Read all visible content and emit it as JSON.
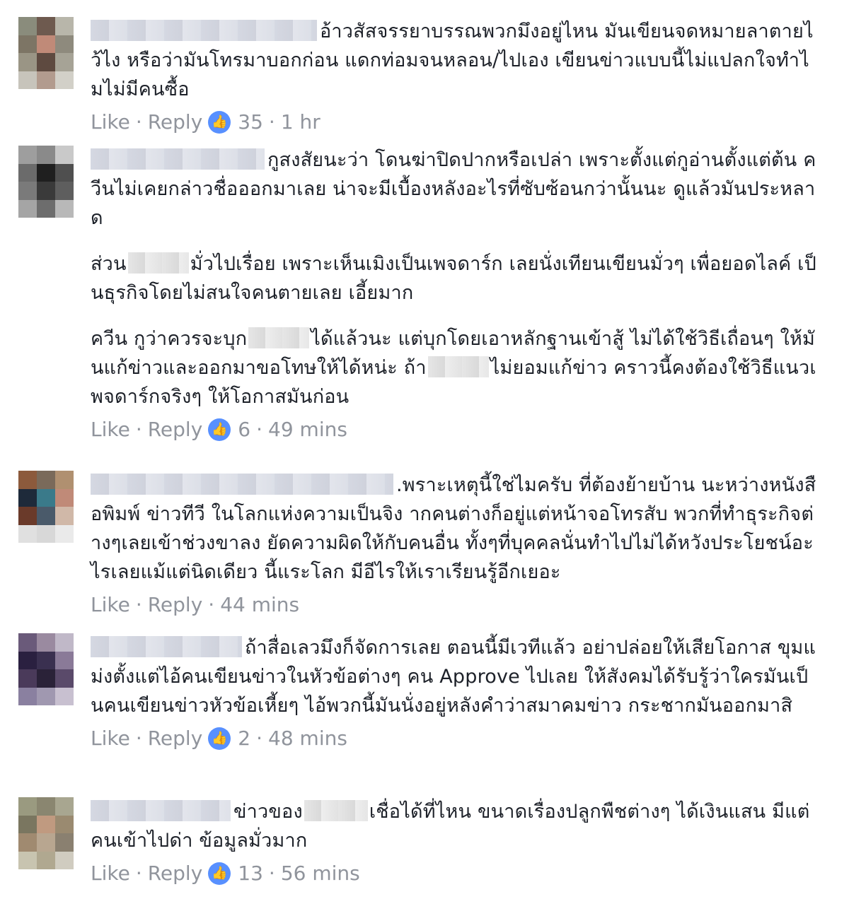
{
  "actions": {
    "like": "Like",
    "reply": "Reply",
    "dot": "·"
  },
  "comments": [
    {
      "paragraphs": [
        "อ้าวสัสจรรยาบรรณพวกมึงอยู่ไหน มันเขียนจดหมายลาตายไว้ไง หรือว่ามันโทรมาบอกก่อน แดกท่อมจนหลอน/ไปเอง เขียนข่าวแบบนี้ไม่แปลกใจทำไมไม่มีคนซื้อ"
      ],
      "likes": "35",
      "time": "1 hr"
    },
    {
      "paragraphs": [
        "กูสงสัยนะว่า โดนฆ่าปิดปากหรือเปล่า เพราะตั้งแต่กูอ่านตั้งแต่ต้น ควีนไม่เคยกล่าวชื่อออกมาเลย น่าจะมีเบื้องหลังอะไรที่ซับซ้อนกว่านั้นนะ ดูแล้วมันประหลาด",
        "มั่วไปเรื่อย เพราะเห็นเมิงเป็นเพจดาร์ก เลยนั่งเทียนเขียนมั่วๆ เพื่อยอดไลค์ เป็นธุรกิจโดยไม่สนใจคนตายเลย เอี้ยมาก",
        "ได้แล้วนะ แต่บุกโดยเอาหลักฐานเข้าสู้ ไม่ได้ใช้วิธีเถื่อนๆ ให้มันแก้ข่าวและออกมาขอโทษให้ได้หน่ะ ถ้า",
        "ไม่ยอมแก้ข่าว คราวนี้คงต้องใช้วิธีแนวเพจดาร์กจริงๆ ให้โอกาสมันก่อน"
      ],
      "p2_prefix": "ส่วน",
      "p3_prefix": "ควีน กูว่าควรจะบุก",
      "likes": "6",
      "time": "49 mins"
    },
    {
      "paragraphs": [
        ".พราะเหตุนี้ใช่ไมครับ ที่ต้องย้ายบ้าน นะหว่างหนังสือพิมพ์ ข่าวทีวี ในโลกแห่งความเป็นจิง ากคนต่างก็อยู่แต่หน้าจอโทรสับ พวกที่ทำธุระกิจต่างๆเลยเข้าช่วงขาลง ยัดความผิดให้กับคนอื่น ทั้งๆที่บุคคลนั่นทำไปไม่ได้หวังประโยชน์อะไรเลยแม้แต่นิดเดียว นี้แระโลก มีอีไรให้เราเรียนรู้อีกเยอะ"
      ],
      "time": "44 mins"
    },
    {
      "paragraphs": [
        "ถ้าสื่อเลวมึงก็จัดการเลย ตอนนี้มีเวทีแล้ว อย่าปล่อยให้เสียโอกาส ขุมแม่งตั้งแต่ไอ้คนเขียนข่าวในหัวข้อต่างๆ คน Approve ไปเลย ให้สังคมได้รับรู้ว่าใครมันเป็นคนเขียนข่าวหัวข้อเหี้ยๆ ไอ้พวกนี้มันนั่งอยู่หลังคำว่าสมาคมข่าว กระชากมันออกมาสิ"
      ],
      "likes": "2",
      "time": "48 mins"
    },
    {
      "paragraphs": [
        "ข่าวของ",
        "เชื่อได้ที่ไหน ขนาดเรื่องปลูกพืชต่างๆ ได้เงินแสน มีแต่คนเข้าไปด่า ข้อมูลมั่วมาก"
      ],
      "likes": "13",
      "time": "56 mins"
    }
  ],
  "colors": {
    "text": "#1d2129",
    "meta": "#90949c",
    "like_badge": "#5890ff"
  },
  "icons": {
    "like": "thumbs-up-icon"
  }
}
